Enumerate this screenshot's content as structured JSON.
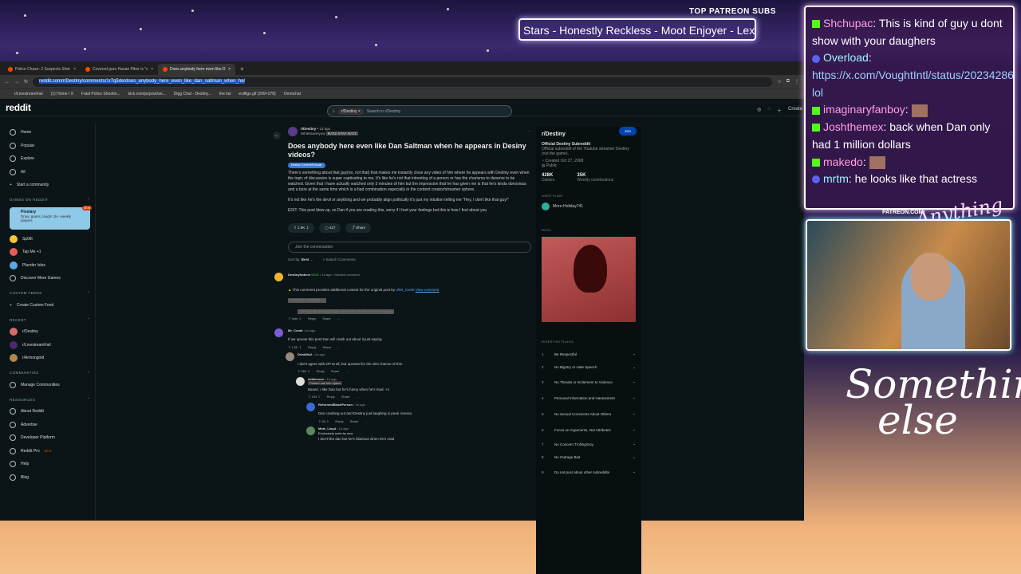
{
  "overlay": {
    "patreon_label": "TOP PATREON SUBS",
    "ticker": "Stars - Honestly Reckless - Moot Enjoyer - Lex",
    "patreon_url": "PATREON.COM/",
    "logo_small": "Anything Else?",
    "logo_big_1": "Something",
    "logo_big_2": "else"
  },
  "chat": [
    {
      "user": "Shchupac",
      "text": "This is kind of guy u dont show with your daughers",
      "platform": "kick"
    },
    {
      "user": "Overload",
      "text": "https://x.com/VoughtIntl/status/2023428627623461057 lol",
      "platform": "discord"
    },
    {
      "user": "imaginaryfanboy",
      "text": "",
      "platform": "kick"
    },
    {
      "user": "Joshthemex",
      "text": "back when Dan only had 1 million dollars",
      "platform": "kick"
    },
    {
      "user": "makedo",
      "text": "",
      "platform": "kick"
    },
    {
      "user": "mrtm",
      "text": "he looks like that actress",
      "platform": "discord"
    }
  ],
  "browser": {
    "tabs": [
      "Police Chase: 2 Suspects Shot",
      "Covered guru Hasan Piker is \"c",
      "Does anybody here even like D"
    ],
    "url": "reddit.com/r/Destiny/comments/1r7q5de/does_anybody_here_even_like_dan_saltman_when_he/",
    "bookmarks": [
      "r/LivestreamFail",
      "(1) Home / X",
      "Fatal Police Shootin...",
      "kick.com/popout/an...",
      "Digg Chat - Destiny...",
      "the list",
      "evilfigs.gif (299×278)",
      "Omnichat"
    ]
  },
  "reddit": {
    "logo": "reddit",
    "search_chip": "r/Destiny",
    "search_placeholder": "Search in r/Destiny",
    "create": "Create",
    "nav": [
      "Home",
      "Popular",
      "Explore",
      "All",
      "Start a community"
    ],
    "games_head": "GAMES ON REDDIT",
    "game_title": "Pixelary",
    "game_desc": "Draw, guess, laugh! 1k+ weekly players",
    "game_badge": "NEW",
    "games": [
      "Sp0tlt",
      "Tap Me +1",
      "Plunder Isles",
      "Discover More Games"
    ],
    "custom_head": "CUSTOM FEEDS",
    "custom": [
      "Create Custom Feed"
    ],
    "recent_head": "RECENT",
    "recent": [
      "r/Destiny",
      "r/LivestreamFail",
      "r/Armongold"
    ],
    "communities_head": "COMMUNITIES",
    "communities": [
      "Manage Communities"
    ],
    "resources_head": "RESOURCES",
    "resources": [
      "About Reddit",
      "Advertise",
      "Developer Platform",
      "Reddit Pro",
      "Help",
      "Blog"
    ],
    "reddit_pro_badge": "BETA"
  },
  "post": {
    "sub": "r/Destiny",
    "time": "• 1d ago",
    "author": "Whitetravelyuw",
    "author_flair": "RATZ STAY RATZ",
    "title": "Does anybody here even like Dan Saltman when he appears in Desiny videos?",
    "flair": "Destiny Content/Podcast",
    "para1": "There's something about that guy(no, not that) that makes me instantly close any video of him where he appears with Destiny even when the topic of discussion is super captivating to me. It's like he's not that intresting of a person or has the charisma to deserve to be watched. Given that I have actually watched only 3 minutes of him but the impression that he has given me is that he's kinda obnoxious and a bore at the same time which is a bad combination especially in the content creator/streamer sphere.",
    "para2": "It's not like he's the devil or anything and we probably align politically it's just my intuition telling me \"Hey, I don't like that guy!\"",
    "para3": "EDIT: This post blew up, so Dan if you are reading this, sorry if I hurt your feelings but this is how I feel about you",
    "votes": "1.9K",
    "comments": "427",
    "share": "Share",
    "join": "Join the conversation",
    "sort": "Sort by:",
    "sort_val": "Best",
    "search_comments": "Search Comments"
  },
  "comments": [
    {
      "author": "DestinyNoticer",
      "badge": "MOD",
      "meta": "• 1d ago • Stickied comment",
      "warn": "This comment provides additional context for the original post by",
      "warn_user": "u/Mr_Comit",
      "warn_link": "View comment",
      "hidden1": "Previous comment ...",
      "hidden2": "I've upvote this post Dan will crash out about it just saying",
      "actions": [
        "Vote",
        "Reply",
        "Share",
        "..."
      ]
    },
    {
      "author": "Mr_Comit",
      "meta": "• 1d ago",
      "text": "If we upvote this post Dan will crash out about it just saying",
      "votes": "1.5K",
      "actions": [
        "Reply",
        "Share",
        "..."
      ]
    },
    {
      "author": "DrinkMo2",
      "meta": "• 1d ago",
      "text": "I don't agree with OP at all, but upvoted for the slim chance of this.",
      "votes": "564",
      "actions": [
        "Reply",
        "Share",
        "..."
      ]
    },
    {
      "author": "dekkerson",
      "meta": "• 1d ago",
      "flair": "Poland can into space",
      "text": "Based. I like Dan but he's funny when he's mad. +1",
      "votes": "193",
      "actions": [
        "Reply",
        "Share",
        "..."
      ]
    },
    {
      "author": "ReformedBlackPerson",
      "meta": "• 1d ago",
      "text": "Dan crashing out and Destiny just laughing is peak cinema.",
      "votes": "65",
      "actions": [
        "Reply",
        "Share",
        "..."
      ]
    },
    {
      "author": "Mole_Lloyd",
      "meta": "• 1d ago",
      "flair": "Exclusively sorts by new",
      "text": "I don't like dan but he's hilarious when he's mad",
      "votes": "",
      "actions": []
    }
  ],
  "sidebar_right": {
    "name": "r/Destiny",
    "join": "Join",
    "title": "Official Destiny Subreddit",
    "desc": "Official subreddit of the Youtube streamer Destiny (not the game).",
    "created": "Created Oct 27, 2008",
    "public": "Public",
    "stat1": "428K",
    "stat1_label": "Dailism",
    "stat2": "35K",
    "stat2_label": "Weekly contributions",
    "user_flair_head": "USER FLAIR",
    "user_flair": "More-Holiday741",
    "dggl_head": "DGGL",
    "rules_head": "R/DESTINY RULES",
    "rules": [
      "Be Respectful",
      "No Bigotry or Hate Speech",
      "No Threats or Incitement to Violence",
      "Personal Information and Harassment",
      "No Sexual Comments About Others",
      "Focus on Arguments, Not Attributes",
      "No Concern Trolling/Soy",
      "No Outrage Bait",
      "Do not post about other subreddits"
    ]
  }
}
